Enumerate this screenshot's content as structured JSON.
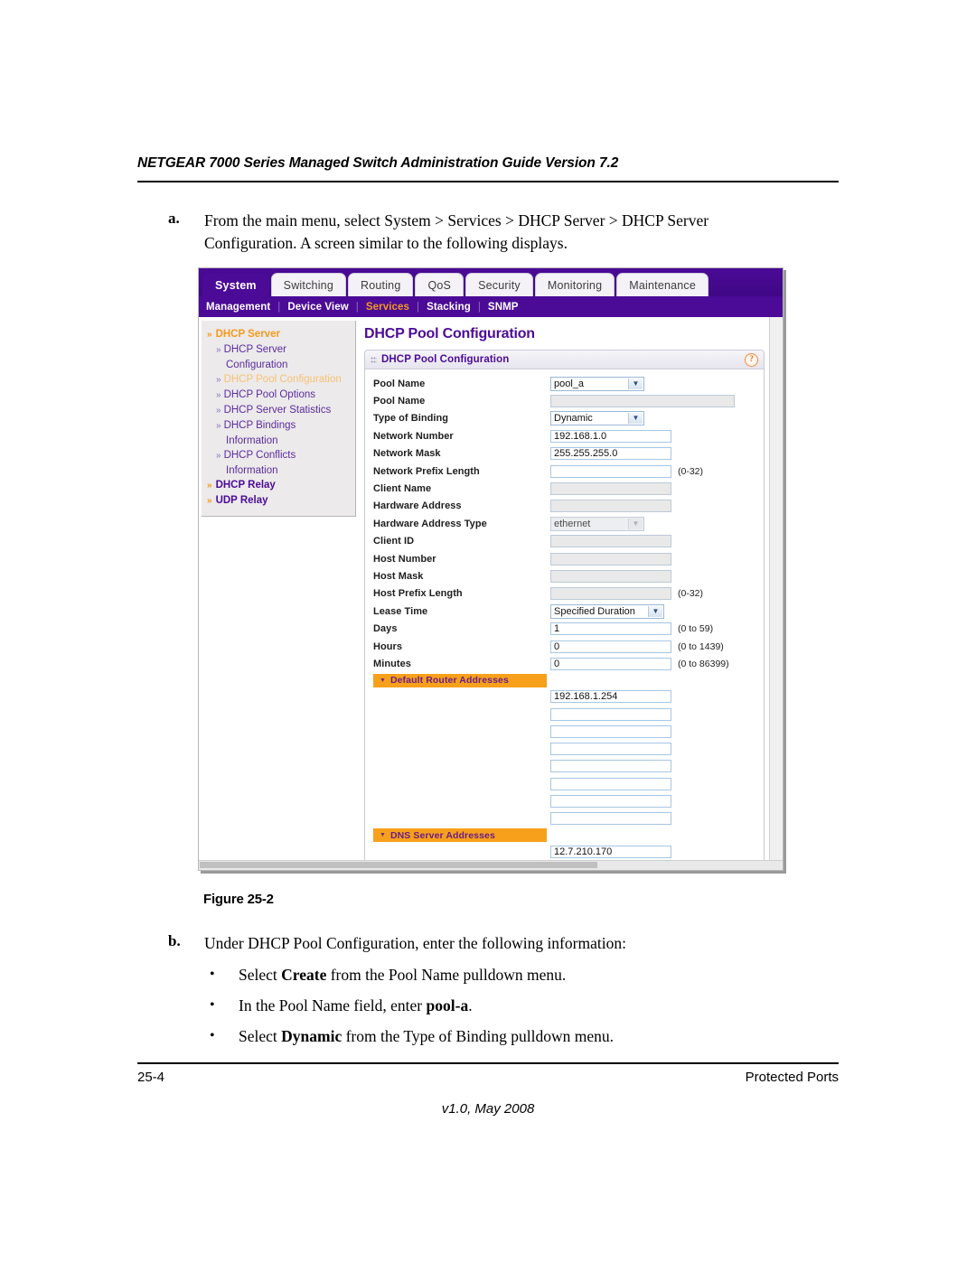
{
  "document": {
    "running_head": "NETGEAR 7000 Series Managed Switch Administration Guide Version 7.2",
    "figure_caption": "Figure 25-2",
    "footer": {
      "page_number": "25-4",
      "chapter_title": "Protected Ports",
      "version_line": "v1.0, May 2008"
    }
  },
  "step_a": {
    "marker": "a.",
    "text": "From the main menu, select System > Services > DHCP Server > DHCP Server Configuration. A screen similar to the following displays."
  },
  "step_b": {
    "marker": "b.",
    "text": "Under DHCP Pool Configuration, enter the following information:",
    "bullets": [
      {
        "pre": "Select ",
        "bold": "Create",
        "post": " from the Pool Name pulldown menu."
      },
      {
        "pre": "In the Pool Name field, enter ",
        "bold": "pool-a",
        "post": "."
      },
      {
        "pre": "Select ",
        "bold": "Dynamic",
        "post": " from the Type of Binding pulldown menu."
      }
    ]
  },
  "screenshot": {
    "tabs": [
      {
        "label": "System",
        "active": true
      },
      {
        "label": "Switching",
        "active": false
      },
      {
        "label": "Routing",
        "active": false
      },
      {
        "label": "QoS",
        "active": false
      },
      {
        "label": "Security",
        "active": false
      },
      {
        "label": "Monitoring",
        "active": false
      },
      {
        "label": "Maintenance",
        "active": false
      }
    ],
    "subnav": [
      {
        "label": "Management",
        "active": false
      },
      {
        "label": "Device View",
        "active": false
      },
      {
        "label": "Services",
        "active": true
      },
      {
        "label": "Stacking",
        "active": false
      },
      {
        "label": "SNMP",
        "active": false
      }
    ],
    "sidebar": [
      {
        "label": "DHCP Server",
        "level": "group",
        "selected": false
      },
      {
        "label": "DHCP Server",
        "level": "sub",
        "selected": false
      },
      {
        "label": "Configuration",
        "level": "sub2",
        "selected": false
      },
      {
        "label": "DHCP Pool Configuration",
        "level": "sub",
        "selected": true
      },
      {
        "label": "DHCP Pool Options",
        "level": "sub",
        "selected": false
      },
      {
        "label": "DHCP Server Statistics",
        "level": "sub",
        "selected": false
      },
      {
        "label": "DHCP Bindings",
        "level": "sub",
        "selected": false
      },
      {
        "label": "Information",
        "level": "sub2",
        "selected": false
      },
      {
        "label": "DHCP Conflicts",
        "level": "sub",
        "selected": false
      },
      {
        "label": "Information",
        "level": "sub2",
        "selected": false
      },
      {
        "label": "DHCP Relay",
        "level": "group2",
        "selected": false
      },
      {
        "label": "UDP Relay",
        "level": "group2",
        "selected": false
      }
    ],
    "page_title": "DHCP Pool Configuration",
    "panel": {
      "title": "DHCP Pool Configuration",
      "help_icon": "question-mark"
    },
    "fields": [
      {
        "label": "Pool Name",
        "type": "select",
        "value": "pool_a",
        "hint": "",
        "disabled": false,
        "wide": false
      },
      {
        "label": "Pool Name",
        "type": "text",
        "value": "",
        "hint": "",
        "disabled": true,
        "wide": true
      },
      {
        "label": "Type of Binding",
        "type": "select",
        "value": "Dynamic",
        "hint": "",
        "disabled": false,
        "wide": false
      },
      {
        "label": "Network Number",
        "type": "text",
        "value": "192.168.1.0",
        "hint": "",
        "disabled": false,
        "wide": false
      },
      {
        "label": "Network Mask",
        "type": "text",
        "value": "255.255.255.0",
        "hint": "",
        "disabled": false,
        "wide": false
      },
      {
        "label": "Network Prefix Length",
        "type": "text",
        "value": "",
        "hint": "(0-32)",
        "disabled": false,
        "wide": false
      },
      {
        "label": "Client Name",
        "type": "text",
        "value": "",
        "hint": "",
        "disabled": true,
        "wide": false
      },
      {
        "label": "Hardware Address",
        "type": "text",
        "value": "",
        "hint": "",
        "disabled": true,
        "wide": false
      },
      {
        "label": "Hardware Address Type",
        "type": "select",
        "value": "ethernet",
        "hint": "",
        "disabled": true,
        "wide": false
      },
      {
        "label": "Client ID",
        "type": "text",
        "value": "",
        "hint": "",
        "disabled": true,
        "wide": false
      },
      {
        "label": "Host Number",
        "type": "text",
        "value": "",
        "hint": "",
        "disabled": true,
        "wide": false
      },
      {
        "label": "Host Mask",
        "type": "text",
        "value": "",
        "hint": "",
        "disabled": true,
        "wide": false
      },
      {
        "label": "Host Prefix Length",
        "type": "text",
        "value": "",
        "hint": "(0-32)",
        "disabled": true,
        "wide": false
      },
      {
        "label": "Lease Time",
        "type": "select",
        "value": "Specified Duration",
        "hint": "",
        "disabled": false,
        "wide": true
      },
      {
        "label": "Days",
        "type": "text",
        "value": "1",
        "hint": "(0 to 59)",
        "disabled": false,
        "wide": false
      },
      {
        "label": "Hours",
        "type": "text",
        "value": "0",
        "hint": "(0 to 1439)",
        "disabled": false,
        "wide": false
      },
      {
        "label": "Minutes",
        "type": "text",
        "value": "0",
        "hint": "(0 to 86399)",
        "disabled": false,
        "wide": false
      }
    ],
    "default_router_section": {
      "title": "Default Router Addresses",
      "addresses": [
        "192.168.1.254",
        "",
        "",
        "",
        "",
        "",
        "",
        ""
      ]
    },
    "dns_server_section": {
      "title": "DNS Server Addresses",
      "addresses": [
        "12.7.210.170"
      ]
    }
  },
  "colors": {
    "brand_purple": "#4B0B97",
    "accent_orange": "#F7A01B",
    "link_purple": "#5B2C9E",
    "selected_nav": "#F7C176"
  }
}
